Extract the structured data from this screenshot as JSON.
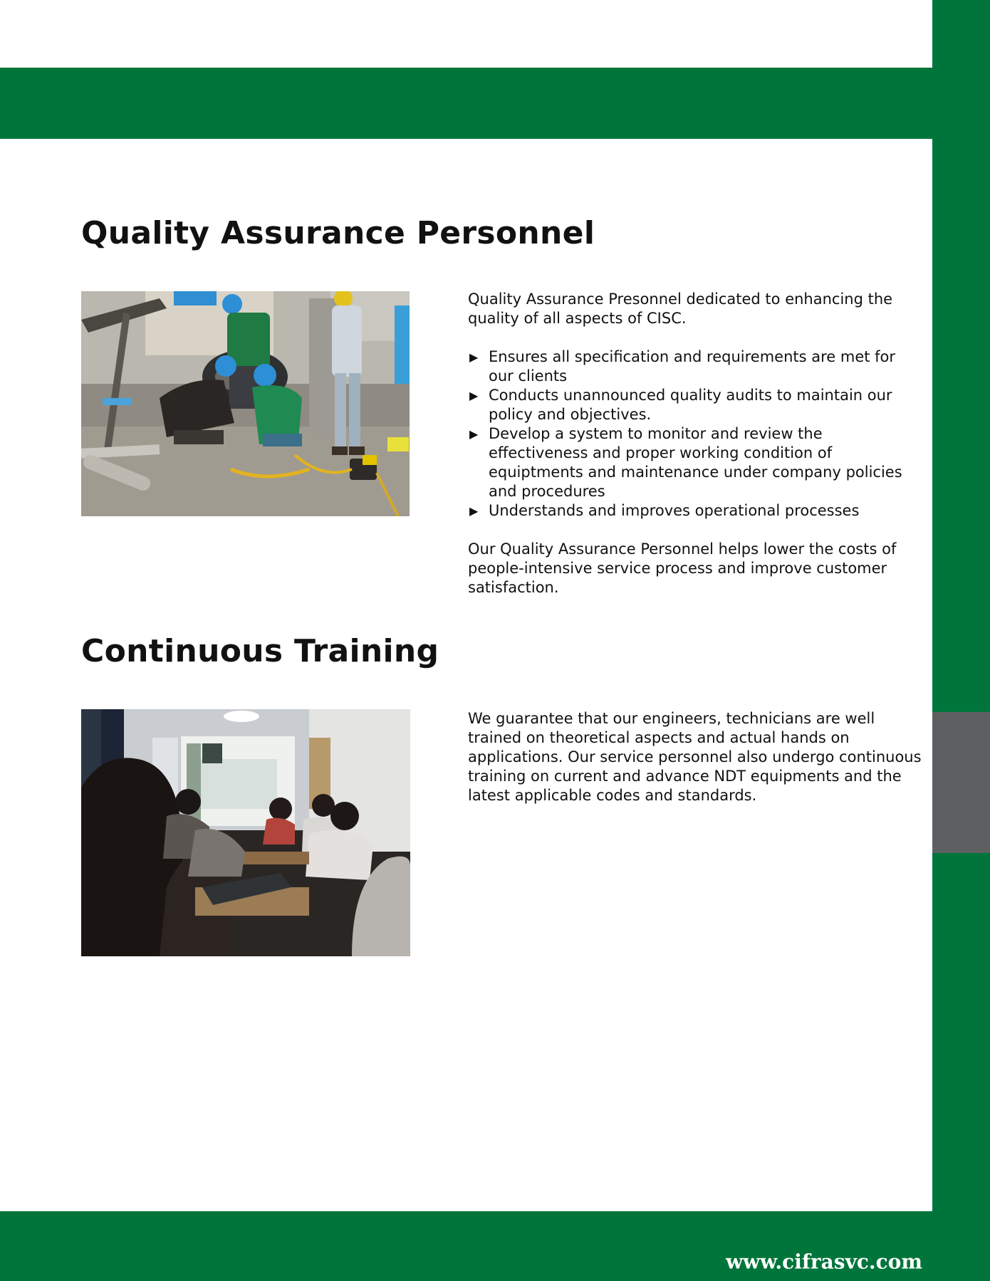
{
  "colors": {
    "brand_green": "#00753b",
    "accent_gray": "#5e5f61"
  },
  "sections": [
    {
      "heading": "Quality Assurance Personnel",
      "intro": "Quality Assurance Presonnel dedicated to enhancing the quality of all aspects of CISC.",
      "bullets": [
        "Ensures all specification and requirements are met for our clients",
        "Conducts unannounced quality audits to maintain our policy and objectives.",
        "Develop a system to monitor and review the effectiveness and proper working condition of equiptments and maintenance  under company policies and procedures",
        "Understands and improves operational processes"
      ],
      "closing": "Our Quality Assurance Personnel helps lower the costs of people-intensive service process and improve customer satisfaction."
    },
    {
      "heading": "Continuous Training",
      "body": "We guarantee that our engineers, technicians are well trained on theoretical aspects and actual hands on applications. Our service personnel also undergo continuous training on current and advance NDT equipments and the latest applicable codes and standards."
    }
  ],
  "footer": {
    "url": "www.cifrasvc.com"
  }
}
